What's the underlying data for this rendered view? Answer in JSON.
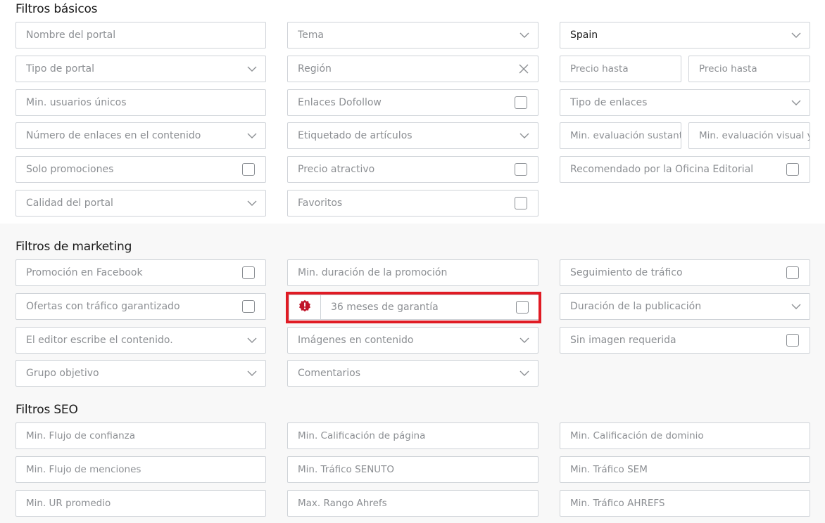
{
  "basic": {
    "title": "Filtros básicos",
    "portal_name": "Nombre del portal",
    "tema": "Tema",
    "country": "Spain",
    "tipo_portal": "Tipo de portal",
    "region": "Región",
    "precio_desde": "Precio hasta",
    "precio_hasta": "Precio hasta",
    "min_usuarios": "Min. usuarios únicos",
    "dofollow": "Enlaces Dofollow",
    "tipo_enlaces": "Tipo de enlaces",
    "num_enlaces": "Número de enlaces en el contenido",
    "etiquetado": "Etiquetado de artículos",
    "min_eval_sustant": "Min. evaluación sustantiva",
    "min_eval_visual": "Min. evaluación visual y",
    "solo_promociones": "Solo promociones",
    "precio_atractivo": "Precio atractivo",
    "recomendado": "Recomendado por la Oficina Editorial",
    "calidad": "Calidad del portal",
    "favoritos": "Favoritos"
  },
  "marketing": {
    "title": "Filtros de marketing",
    "facebook": "Promoción en Facebook",
    "min_duracion": "Min. duración de la promoción",
    "seguimiento": "Seguimiento de tráfico",
    "ofertas_trafico": "Ofertas con tráfico garantizado",
    "garantia": "36 meses de garantía",
    "duracion_publicacion": "Duración de la publicación",
    "editor": "El editor escribe el contenido.",
    "imagenes": "Imágenes en contenido",
    "sin_imagen": "Sin imagen requerida",
    "grupo": "Grupo objetivo",
    "comentarios": "Comentarios"
  },
  "seo": {
    "title": "Filtros SEO",
    "flujo_confianza": "Min. Flujo de confianza",
    "calif_pagina": "Min. Calificación de página",
    "calif_dominio": "Min. Calificación de dominio",
    "flujo_menciones": "Min. Flujo de menciones",
    "trafico_senuto": "Min. Tráfico SENUTO",
    "trafico_sem": "Min. Tráfico SEM",
    "ur_promedio": "Min. UR promedio",
    "rango_ahrefs": "Max. Rango Ahrefs",
    "trafico_ahrefs": "Min. Tráfico AHREFS"
  },
  "colors": {
    "highlight": "#e01b24",
    "warning_icon": "#c0152a",
    "border": "#cfd3d8"
  },
  "icons": [
    "chevron-down-icon",
    "close-icon",
    "warning-badge-icon"
  ]
}
